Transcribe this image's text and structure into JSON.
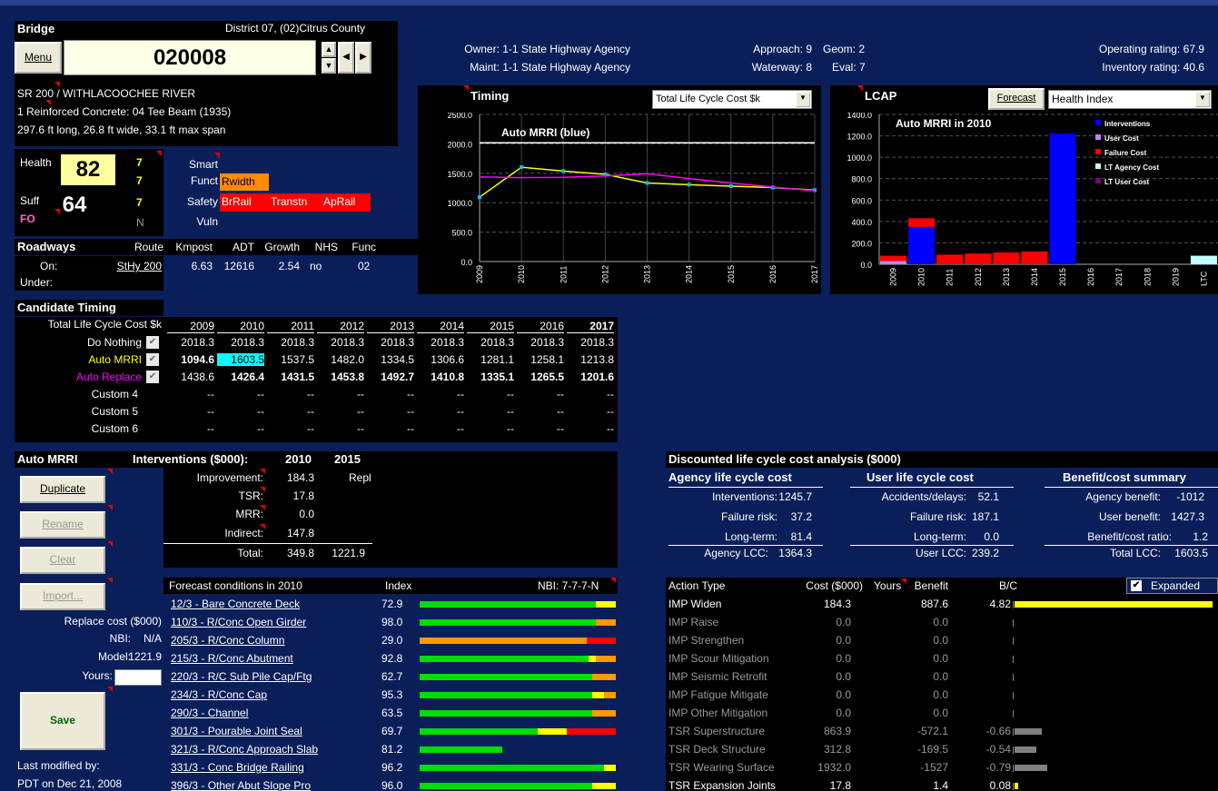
{
  "bridge": {
    "section_title": "Bridge",
    "district": "District 07, (02)Citrus County",
    "menu_label": "Menu",
    "id": "020008",
    "route_line": "SR 200 / WITHLACOOCHEE RIVER",
    "type_line": "1 Reinforced Concrete: 04 Tee Beam (1935)",
    "dims_line": "297.6 ft long, 26.8 ft wide, 33.1 ft max span"
  },
  "ratings": {
    "owner": "Owner: 1-1 State Highway Agency",
    "maint": "Maint: 1-1 State Highway Agency",
    "approach": "Approach: 9",
    "waterway": "Waterway: 8",
    "geom": "Geom: 2",
    "eval": "Eval: 7",
    "operating": "Operating rating: 67.9",
    "inventory": "Inventory rating: 40.6"
  },
  "health": {
    "health_label": "Health",
    "health_value": "82",
    "suff_label": "Suff",
    "suff_value": "64",
    "fo_label": "FO",
    "n1": "7",
    "n2": "7",
    "n3": "7",
    "n_label": "N"
  },
  "flags": {
    "smart": "Smart",
    "funct": "Funct",
    "safety": "Safety",
    "vuln": "Vuln",
    "rwidth": "Rwidth",
    "brrail": "BrRail",
    "transtn": "Transtn",
    "aprail": "ApRail"
  },
  "roadways": {
    "title": "Roadways",
    "headers": [
      "Route",
      "Kmpost",
      "ADT",
      "Growth",
      "NHS",
      "Func"
    ],
    "on_label": "On:",
    "under_label": "Under:",
    "route": "StHy 200",
    "kmpost": "6.63",
    "adt": "12616",
    "growth": "2.54",
    "nhs": "no",
    "func": "02"
  },
  "timing_chart": {
    "title": "Timing",
    "dropdown": "Total Life Cycle Cost $k",
    "subtitle": "Auto MRRI (blue)"
  },
  "lcap_chart": {
    "title": "LCAP",
    "forecast_button": "Forecast",
    "dropdown": "Health Index",
    "subtitle": "Auto MRRI in 2010",
    "legend": [
      "Interventions",
      "User Cost",
      "Failure Cost",
      "LT Agency Cost",
      "LT User Cost"
    ]
  },
  "chart_data": [
    {
      "type": "line",
      "title": "Auto MRRI (blue)",
      "x": [
        "2009",
        "2010",
        "2011",
        "2012",
        "2013",
        "2014",
        "2015",
        "2016",
        "2017"
      ],
      "ylim": [
        0,
        2500
      ],
      "yticks": [
        "0.0",
        "500.0",
        "1000.0",
        "1500.0",
        "2000.0",
        "2500.0"
      ],
      "series": [
        {
          "name": "Do Nothing",
          "color": "#ffffff",
          "values": [
            2018.3,
            2018.3,
            2018.3,
            2018.3,
            2018.3,
            2018.3,
            2018.3,
            2018.3,
            2018.3
          ]
        },
        {
          "name": "Auto MRRI",
          "color": "#ffff00",
          "values": [
            1094.6,
            1603.5,
            1537.5,
            1482.0,
            1334.5,
            1306.6,
            1281.1,
            1258.1,
            1213.8
          ]
        },
        {
          "name": "Auto Replace",
          "color": "#ff00ff",
          "values": [
            1438.6,
            1426.4,
            1431.5,
            1453.8,
            1492.7,
            1410.8,
            1335.1,
            1265.5,
            1201.6
          ]
        }
      ]
    },
    {
      "type": "bar",
      "title": "Auto MRRI in 2010",
      "categories": [
        "2009",
        "2010",
        "2011",
        "2012",
        "2013",
        "2014",
        "2015",
        "2016",
        "2017",
        "2018",
        "2019",
        "LTC"
      ],
      "ylim": [
        0,
        1400
      ],
      "yticks": [
        "0.0",
        "200.0",
        "400.0",
        "600.0",
        "800.0",
        "1000.0",
        "1200.0",
        "1400.0"
      ],
      "series": [
        {
          "name": "Interventions",
          "color": "#0000ff",
          "values": [
            0,
            350,
            0,
            0,
            0,
            0,
            1222,
            0,
            0,
            0,
            0,
            0
          ]
        },
        {
          "name": "User Cost",
          "color": "#c080ff",
          "values": [
            30,
            0,
            0,
            0,
            0,
            0,
            0,
            0,
            0,
            0,
            0,
            0
          ]
        },
        {
          "name": "Failure Cost",
          "color": "#ff0000",
          "values": [
            50,
            80,
            90,
            100,
            110,
            120,
            0,
            0,
            0,
            0,
            0,
            0
          ]
        },
        {
          "name": "LT Agency Cost",
          "color": "#c0ffff",
          "values": [
            0,
            0,
            0,
            0,
            0,
            0,
            0,
            0,
            0,
            0,
            0,
            80
          ]
        },
        {
          "name": "LT User Cost",
          "color": "#800080",
          "values": [
            0,
            0,
            0,
            0,
            0,
            0,
            0,
            0,
            0,
            0,
            0,
            0
          ]
        }
      ]
    }
  ],
  "candidate": {
    "title": "Candidate Timing",
    "label": "Total Life Cycle Cost $k",
    "years": [
      "2009",
      "2010",
      "2011",
      "2012",
      "2013",
      "2014",
      "2015",
      "2016",
      "2017"
    ],
    "rows": [
      {
        "name": "Do Nothing",
        "vals": [
          "2018.3",
          "2018.3",
          "2018.3",
          "2018.3",
          "2018.3",
          "2018.3",
          "2018.3",
          "2018.3",
          "2018.3"
        ]
      },
      {
        "name": "Auto MRRI",
        "vals": [
          "1094.6",
          "1603.5",
          "1537.5",
          "1482.0",
          "1334.5",
          "1306.6",
          "1281.1",
          "1258.1",
          "1213.8"
        ]
      },
      {
        "name": "Auto Replace",
        "vals": [
          "1438.6",
          "1426.4",
          "1431.5",
          "1453.8",
          "1492.7",
          "1410.8",
          "1335.1",
          "1265.5",
          "1201.6"
        ]
      },
      {
        "name": "Custom 4",
        "vals": [
          "--",
          "--",
          "--",
          "--",
          "--",
          "--",
          "--",
          "--",
          "--"
        ]
      },
      {
        "name": "Custom 5",
        "vals": [
          "--",
          "--",
          "--",
          "--",
          "--",
          "--",
          "--",
          "--",
          "--"
        ]
      },
      {
        "name": "Custom 6",
        "vals": [
          "--",
          "--",
          "--",
          "--",
          "--",
          "--",
          "--",
          "--",
          "--"
        ]
      }
    ]
  },
  "automrri": {
    "title": "Auto MRRI",
    "duplicate": "Duplicate",
    "rename": "Rename",
    "clear": "Clear",
    "import": "Import...",
    "replace_cost": "Replace cost ($000)",
    "nbi_label": "NBI:",
    "nbi_value": "N/A",
    "model_label": "Model:",
    "model_value": "1221.9",
    "yours_label": "Yours:",
    "save": "Save",
    "last_mod_label": "Last modified by:",
    "last_mod_value": "PDT on Dec 21, 2008"
  },
  "interventions": {
    "title": "Interventions ($000):",
    "y1": "2010",
    "y2": "2015",
    "improvement_label": "Improvement:",
    "improvement_1": "184.3",
    "improvement_2": "Repl",
    "tsr_label": "TSR:",
    "tsr_1": "17.8",
    "mrr_label": "MRR:",
    "mrr_1": "0.0",
    "indirect_label": "Indirect:",
    "indirect_1": "147.8",
    "total_label": "Total:",
    "total_1": "349.8",
    "total_2": "1221.9"
  },
  "forecast": {
    "title": "Forecast conditions in 2010",
    "index_label": "Index",
    "nbi_label": "NBI: 7-7-7-N",
    "rows": [
      {
        "name": "12/3 - Bare Concrete Deck",
        "index": "72.9",
        "g": 0.9,
        "y": 0.1,
        "o": 0,
        "r": 0
      },
      {
        "name": "110/3 - R/Conc Open Girder",
        "index": "98.0",
        "g": 0.9,
        "y": 0,
        "o": 0.1,
        "r": 0
      },
      {
        "name": "205/3 - R/Conc Column",
        "index": "29.0",
        "g": 0,
        "y": 0,
        "o": 0.85,
        "r": 0.15
      },
      {
        "name": "215/3 - R/Conc Abutment",
        "index": "92.8",
        "g": 0.86,
        "y": 0.04,
        "o": 0.1,
        "r": 0
      },
      {
        "name": "220/3 - R/C Sub Pile Cap/Ftg",
        "index": "62.7",
        "g": 0.88,
        "y": 0,
        "o": 0.12,
        "r": 0
      },
      {
        "name": "234/3 - R/Conc Cap",
        "index": "95.3",
        "g": 0.88,
        "y": 0.06,
        "o": 0.06,
        "r": 0
      },
      {
        "name": "290/3 - Channel",
        "index": "63.5",
        "g": 0.88,
        "y": 0,
        "o": 0.12,
        "r": 0
      },
      {
        "name": "301/3 - Pourable Joint Seal",
        "index": "69.7",
        "g": 0.6,
        "y": 0.15,
        "o": 0,
        "r": 0.25
      },
      {
        "name": "321/3 - R/Conc Approach Slab",
        "index": "81.2",
        "g": 0.42,
        "y": 0,
        "o": 0,
        "r": 0
      },
      {
        "name": "331/3 - Conc Bridge Railing",
        "index": "96.2",
        "g": 0.94,
        "y": 0.06,
        "o": 0,
        "r": 0
      },
      {
        "name": "396/3 - Other Abut Slope Pro",
        "index": "96.0",
        "g": 0.88,
        "y": 0.12,
        "o": 0,
        "r": 0
      }
    ]
  },
  "dlcc": {
    "title": "Discounted life cycle cost analysis ($000)",
    "agency_title": "Agency life cycle cost",
    "user_title": "User life cycle cost",
    "bc_title": "Benefit/cost summary",
    "a1l": "Interventions:",
    "a1v": "1245.7",
    "a2l": "Failure risk:",
    "a2v": "37.2",
    "a3l": "Long-term:",
    "a3v": "81.4",
    "a4l": "Agency LCC:",
    "a4v": "1364.3",
    "u1l": "Accidents/delays:",
    "u1v": "52.1",
    "u2l": "Failure risk:",
    "u2v": "187.1",
    "u3l": "Long-term:",
    "u3v": "0.0",
    "u4l": "User LCC:",
    "u4v": "239.2",
    "b1l": "Agency benefit:",
    "b1v": "-1012",
    "b2l": "User benefit:",
    "b2v": "1427.3",
    "b3l": "Benefit/cost ratio:",
    "b3v": "1.2",
    "b4l": "Total LCC:",
    "b4v": "1603.5"
  },
  "actions": {
    "h_type": "Action Type",
    "h_cost": "Cost ($000)",
    "h_yours": "Yours",
    "h_benefit": "Benefit",
    "h_bc": "B/C",
    "expanded": "Expanded",
    "rows": [
      {
        "name": "IMP Widen",
        "cost": "184.3",
        "benefit": "887.6",
        "bc": "4.82",
        "active": true,
        "bcv": 4.82,
        "color": "#ffff00"
      },
      {
        "name": "IMP Raise",
        "cost": "0.0",
        "benefit": "0.0",
        "bc": "",
        "active": false,
        "bcv": 0,
        "color": ""
      },
      {
        "name": "IMP Strengthen",
        "cost": "0.0",
        "benefit": "0.0",
        "bc": "",
        "active": false,
        "bcv": 0,
        "color": ""
      },
      {
        "name": "IMP Scour Mitigation",
        "cost": "0.0",
        "benefit": "0.0",
        "bc": "",
        "active": false,
        "bcv": 0,
        "color": ""
      },
      {
        "name": "IMP Seismic Retrofit",
        "cost": "0.0",
        "benefit": "0.0",
        "bc": "",
        "active": false,
        "bcv": 0,
        "color": ""
      },
      {
        "name": "IMP Fatigue Mitigate",
        "cost": "0.0",
        "benefit": "0.0",
        "bc": "",
        "active": false,
        "bcv": 0,
        "color": ""
      },
      {
        "name": "IMP Other Mitigation",
        "cost": "0.0",
        "benefit": "0.0",
        "bc": "",
        "active": false,
        "bcv": 0,
        "color": ""
      },
      {
        "name": "TSR Superstructure",
        "cost": "863.9",
        "benefit": "-572.1",
        "bc": "-0.66",
        "active": false,
        "bcv": 0.66,
        "color": "#808080"
      },
      {
        "name": "TSR Deck Structure",
        "cost": "312.8",
        "benefit": "-169.5",
        "bc": "-0.54",
        "active": false,
        "bcv": 0.54,
        "color": "#808080"
      },
      {
        "name": "TSR Wearing Surface",
        "cost": "1932.0",
        "benefit": "-1527",
        "bc": "-0.79",
        "active": false,
        "bcv": 0.79,
        "color": "#808080"
      },
      {
        "name": "TSR Expansion Joints",
        "cost": "17.8",
        "benefit": "1.4",
        "bc": "0.08",
        "active": true,
        "bcv": 0.08,
        "color": "#ffff00"
      }
    ]
  }
}
